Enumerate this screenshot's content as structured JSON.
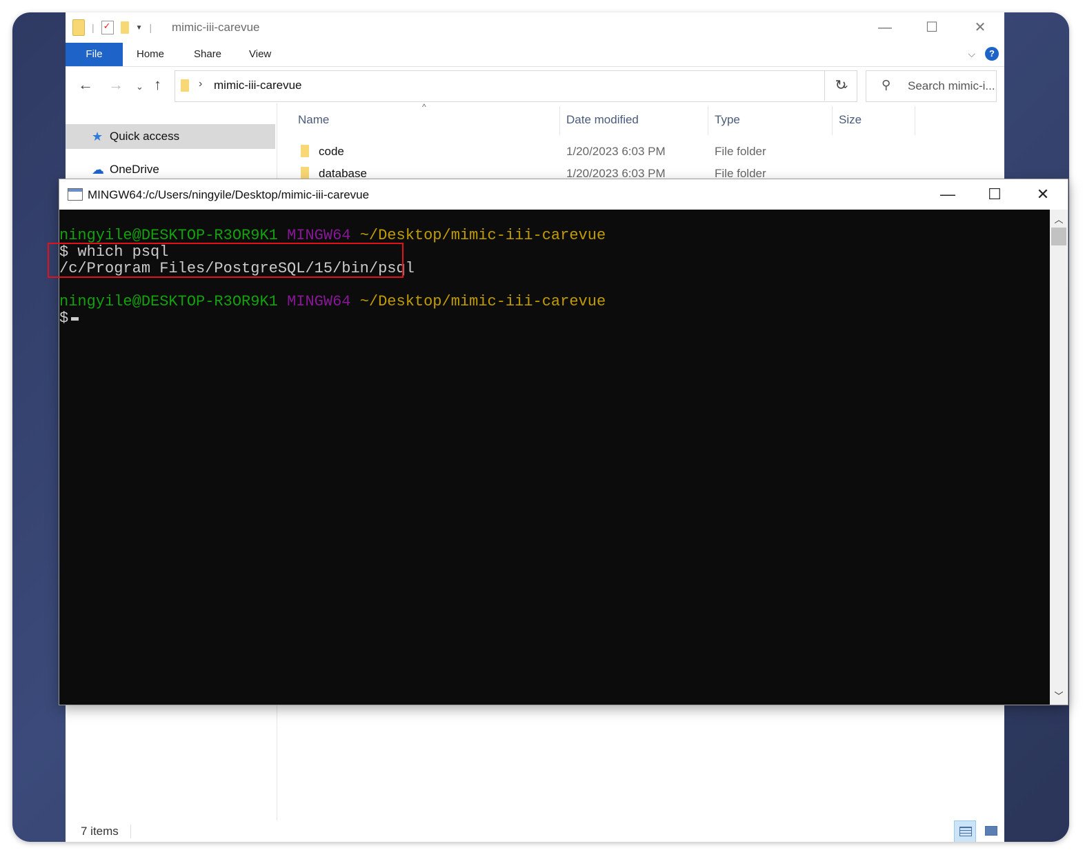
{
  "explorer": {
    "title": "mimic-iii-carevue",
    "ribbon_tabs": [
      "File",
      "Home",
      "Share",
      "View"
    ],
    "address_path": "mimic-iii-carevue",
    "search_placeholder": "Search mimic-i...",
    "nav_items": [
      {
        "label": "Quick access",
        "icon": "star-icon",
        "selected": true
      },
      {
        "label": "OneDrive",
        "icon": "cloud-icon",
        "selected": false
      }
    ],
    "columns": [
      "Name",
      "Date modified",
      "Type",
      "Size"
    ],
    "rows": [
      {
        "name": "code",
        "date": "1/20/2023 6:03 PM",
        "type": "File folder"
      },
      {
        "name": "database",
        "date": "1/20/2023 6:03 PM",
        "type": "File folder"
      }
    ],
    "status_count": "7 items"
  },
  "terminal": {
    "title": "MINGW64:/c/Users/ningyile/Desktop/mimic-iii-carevue",
    "prompt_user": "ningyile@DESKTOP-R3OR9K1",
    "prompt_env": "MINGW64",
    "prompt_path": "~/Desktop/mimic-iii-carevue",
    "command": "$ which psql",
    "output": "/c/Program Files/PostgreSQL/15/bin/psql",
    "prompt_symbol": "$",
    "colors": {
      "user": "#13a10e",
      "env": "#881798",
      "path": "#c19c00",
      "text": "#cccccc",
      "highlight": "#e0121a"
    }
  }
}
